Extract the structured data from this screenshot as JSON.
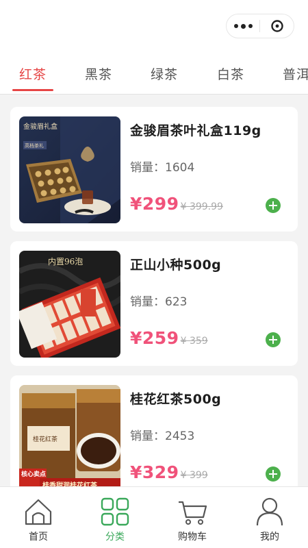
{
  "capsule": {
    "more_icon": "more-dots-icon",
    "close_icon": "close-circle-icon"
  },
  "categories": {
    "tabs": [
      "红茶",
      "黑茶",
      "绿茶",
      "白茶",
      "普洱"
    ],
    "active_index": 0,
    "active_color": "#e64545"
  },
  "products": [
    {
      "name": "金骏眉茶叶礼盒119g",
      "sales_label": "销量：",
      "sales": "1604",
      "price": "¥299",
      "original_price": "¥ 399.99",
      "image_text": "金骏眉礼盒",
      "image_subtext": "高档茶礼"
    },
    {
      "name": "正山小种500g",
      "sales_label": "销量：",
      "sales": "623",
      "price": "¥259",
      "original_price": "¥ 359",
      "image_text": "内置96泡"
    },
    {
      "name": "桂花红茶500g",
      "sales_label": "销量：",
      "sales": "2453",
      "price": "¥329",
      "original_price": "¥ 399",
      "image_text": "核心卖点",
      "image_subtext": "桂香甜润桂花红茶",
      "image_label": "桂花红茶"
    }
  ],
  "price_color": "#f0527a",
  "add_button_color": "#4cb04c",
  "tabbar": {
    "items": [
      {
        "label": "首页",
        "icon": "home-icon"
      },
      {
        "label": "分类",
        "icon": "category-grid-icon"
      },
      {
        "label": "购物车",
        "icon": "cart-icon"
      },
      {
        "label": "我的",
        "icon": "user-icon"
      }
    ],
    "active_index": 1,
    "active_color": "#3aa85a"
  }
}
